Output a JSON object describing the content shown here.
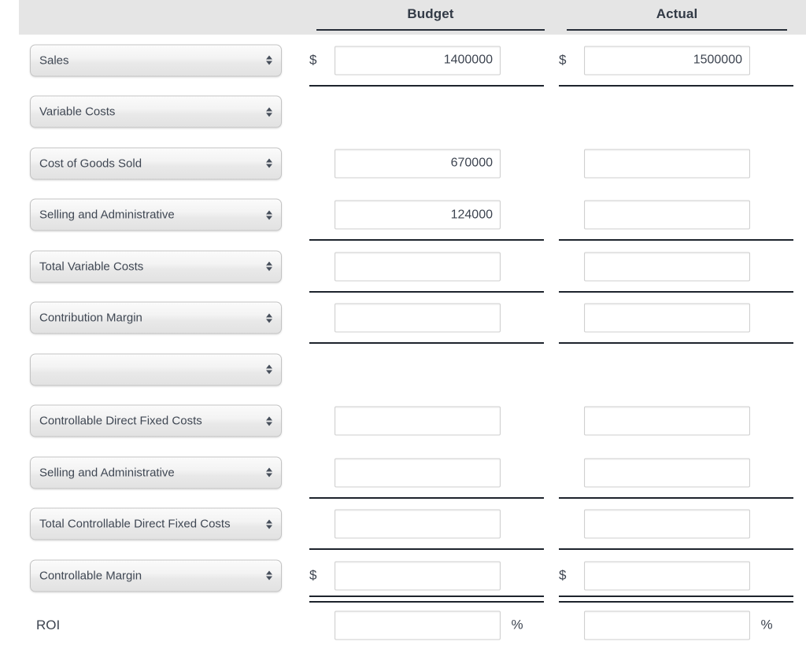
{
  "header": {
    "spacer_label": "",
    "columns": [
      {
        "label": "Budget"
      },
      {
        "label": "Actual"
      }
    ]
  },
  "currency_symbol": "$",
  "percent_symbol": "%",
  "input_placeholder": "",
  "rows": [
    {
      "name": "sales",
      "kind": "select",
      "label": "Sales",
      "budget": {
        "show_input": true,
        "value": "1400000",
        "dollar": true,
        "percent": false
      },
      "actual": {
        "show_input": true,
        "value": "1500000",
        "dollar": true,
        "percent": false
      },
      "rule": "single"
    },
    {
      "name": "variable-costs",
      "kind": "select",
      "label": "Variable Costs",
      "budget": {
        "show_input": false,
        "value": "",
        "dollar": false,
        "percent": false
      },
      "actual": {
        "show_input": false,
        "value": "",
        "dollar": false,
        "percent": false
      },
      "rule": "none"
    },
    {
      "name": "cost-of-goods-sold",
      "kind": "select",
      "label": "Cost of Goods Sold",
      "budget": {
        "show_input": true,
        "value": "670000",
        "dollar": false,
        "percent": false
      },
      "actual": {
        "show_input": true,
        "value": "",
        "dollar": false,
        "percent": false
      },
      "rule": "none"
    },
    {
      "name": "selling-and-administrative-variable",
      "kind": "select",
      "label": "Selling and Administrative",
      "budget": {
        "show_input": true,
        "value": "124000",
        "dollar": false,
        "percent": false
      },
      "actual": {
        "show_input": true,
        "value": "",
        "dollar": false,
        "percent": false
      },
      "rule": "single"
    },
    {
      "name": "total-variable-costs",
      "kind": "select",
      "label": "Total Variable Costs",
      "budget": {
        "show_input": true,
        "value": "",
        "dollar": false,
        "percent": false
      },
      "actual": {
        "show_input": true,
        "value": "",
        "dollar": false,
        "percent": false
      },
      "rule": "single"
    },
    {
      "name": "contribution-margin",
      "kind": "select",
      "label": "Contribution Margin",
      "budget": {
        "show_input": true,
        "value": "",
        "dollar": false,
        "percent": false
      },
      "actual": {
        "show_input": true,
        "value": "",
        "dollar": false,
        "percent": false
      },
      "rule": "single"
    },
    {
      "name": "blank-category",
      "kind": "select",
      "label": "",
      "budget": {
        "show_input": false,
        "value": "",
        "dollar": false,
        "percent": false
      },
      "actual": {
        "show_input": false,
        "value": "",
        "dollar": false,
        "percent": false
      },
      "rule": "none"
    },
    {
      "name": "controllable-direct-fixed-costs",
      "kind": "select",
      "label": "Controllable Direct Fixed Costs",
      "budget": {
        "show_input": true,
        "value": "",
        "dollar": false,
        "percent": false
      },
      "actual": {
        "show_input": true,
        "value": "",
        "dollar": false,
        "percent": false
      },
      "rule": "none"
    },
    {
      "name": "selling-and-administrative-fixed",
      "kind": "select",
      "label": "Selling and Administrative",
      "budget": {
        "show_input": true,
        "value": "",
        "dollar": false,
        "percent": false
      },
      "actual": {
        "show_input": true,
        "value": "",
        "dollar": false,
        "percent": false
      },
      "rule": "single"
    },
    {
      "name": "total-controllable-direct-fixed-costs",
      "kind": "select",
      "label": "Total Controllable Direct Fixed Costs",
      "budget": {
        "show_input": true,
        "value": "",
        "dollar": false,
        "percent": false
      },
      "actual": {
        "show_input": true,
        "value": "",
        "dollar": false,
        "percent": false
      },
      "rule": "single"
    },
    {
      "name": "controllable-margin",
      "kind": "select",
      "label": "Controllable Margin",
      "budget": {
        "show_input": true,
        "value": "",
        "dollar": true,
        "percent": false
      },
      "actual": {
        "show_input": true,
        "value": "",
        "dollar": true,
        "percent": false
      },
      "rule": "double"
    },
    {
      "name": "roi",
      "kind": "text",
      "label": "ROI",
      "budget": {
        "show_input": true,
        "value": "",
        "dollar": false,
        "percent": true
      },
      "actual": {
        "show_input": true,
        "value": "",
        "dollar": false,
        "percent": true
      },
      "rule": "none"
    }
  ]
}
